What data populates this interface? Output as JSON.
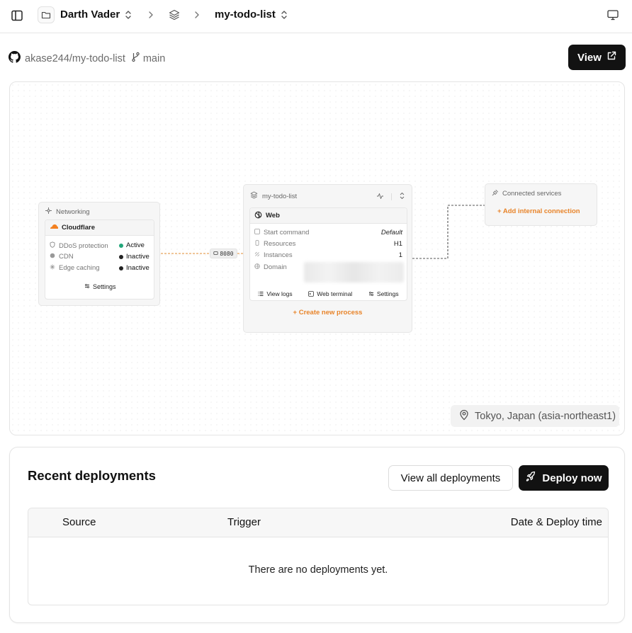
{
  "topbar": {
    "org_name": "Darth Vader",
    "project_name": "my-todo-list"
  },
  "repo": {
    "name": "akase244/my-todo-list",
    "branch": "main",
    "view_label": "View"
  },
  "canvas": {
    "networking": {
      "title": "Networking",
      "provider": "Cloudflare",
      "rows": [
        {
          "label": "DDoS protection",
          "status": "Active",
          "status_color": "#22a67a"
        },
        {
          "label": "CDN",
          "status": "Inactive",
          "status_color": "#222222"
        },
        {
          "label": "Edge caching",
          "status": "Inactive",
          "status_color": "#222222"
        }
      ],
      "settings_label": "Settings"
    },
    "port": "8080",
    "service": {
      "title": "my-todo-list",
      "process_name": "Web",
      "rows": [
        {
          "label": "Start command",
          "value": "Default"
        },
        {
          "label": "Resources",
          "value": "H1"
        },
        {
          "label": "Instances",
          "value": "1"
        },
        {
          "label": "Domain",
          "value": ""
        }
      ],
      "actions": [
        "View logs",
        "Web terminal",
        "Settings"
      ],
      "create_process_label": "+ Create new process"
    },
    "connected": {
      "title": "Connected services",
      "add_label": "+ Add internal connection"
    },
    "region": "Tokyo, Japan (asia-northeast1)"
  },
  "deployments": {
    "title": "Recent deployments",
    "view_all_label": "View all deployments",
    "deploy_label": "Deploy now",
    "columns": [
      "Source",
      "Trigger",
      "Date & Deploy time"
    ],
    "empty_text": "There are no deployments yet."
  },
  "colors": {
    "accent": "#e8842a",
    "dark_button": "#121212"
  }
}
